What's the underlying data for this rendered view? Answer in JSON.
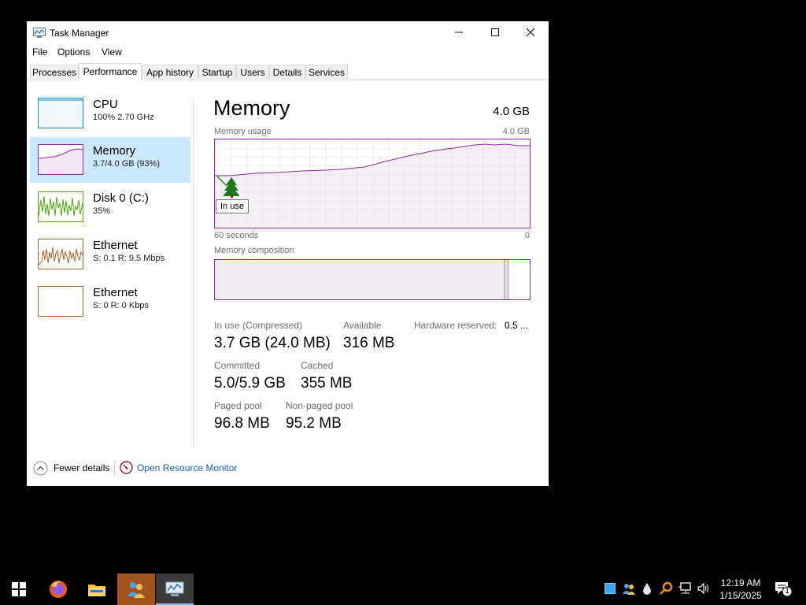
{
  "window": {
    "title": "Task Manager",
    "menu": [
      "File",
      "Options",
      "View"
    ],
    "tabs": [
      "Processes",
      "Performance",
      "App history",
      "Startup",
      "Users",
      "Details",
      "Services"
    ],
    "active_tab": "Performance"
  },
  "sidebar": [
    {
      "title": "CPU",
      "sub": "100%  2.70 GHz",
      "color": "#1b8bc7"
    },
    {
      "title": "Memory",
      "sub": "3.7/4.0 GB (93%)",
      "color": "#8b2a9a",
      "selected": true
    },
    {
      "title": "Disk 0 (C:)",
      "sub": "35%",
      "color": "#4da60c"
    },
    {
      "title": "Ethernet",
      "sub": "S: 0.1  R: 9.5 Mbps",
      "color": "#a7612a"
    },
    {
      "title": "Ethernet",
      "sub": "S: 0  R: 0 Kbps",
      "color": "#a7612a"
    }
  ],
  "main": {
    "title": "Memory",
    "total": "4.0 GB",
    "usage_label": "Memory usage",
    "usage_max": "4.0 GB",
    "time_left": "60 seconds",
    "time_right": "0",
    "tooltip": "In use",
    "composition_label": "Memory composition",
    "stats": {
      "in_use_label": "In use (Compressed)",
      "in_use_value": "3.7 GB (24.0 MB)",
      "available_label": "Available",
      "available_value": "316 MB",
      "hw_label": "Hardware reserved:",
      "hw_value": "0.5 ...",
      "committed_label": "Committed",
      "committed_value": "5.0/5.9 GB",
      "cached_label": "Cached",
      "cached_value": "355 MB",
      "paged_label": "Paged pool",
      "paged_value": "96.8 MB",
      "nonpaged_label": "Non-paged pool",
      "nonpaged_value": "95.2 MB"
    }
  },
  "footer": {
    "fewer_details": "Fewer details",
    "open_resource_monitor": "Open Resource Monitor"
  },
  "taskbar": {
    "time": "12:19 AM",
    "date": "1/15/2025",
    "notification_count": "1"
  },
  "colors": {
    "memory_accent": "#8b2a9a",
    "selection": "#cce8ff",
    "link": "#1a5fb4",
    "taskbar_active": "#a0531d"
  }
}
